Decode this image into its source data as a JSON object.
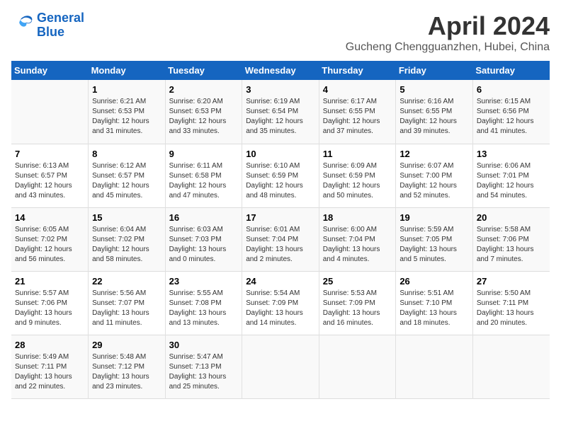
{
  "logo": {
    "line1": "General",
    "line2": "Blue"
  },
  "title": "April 2024",
  "location": "Gucheng Chengguanzhen, Hubei, China",
  "days_header": [
    "Sunday",
    "Monday",
    "Tuesday",
    "Wednesday",
    "Thursday",
    "Friday",
    "Saturday"
  ],
  "weeks": [
    [
      {
        "day": "",
        "info": ""
      },
      {
        "day": "1",
        "info": "Sunrise: 6:21 AM\nSunset: 6:53 PM\nDaylight: 12 hours\nand 31 minutes."
      },
      {
        "day": "2",
        "info": "Sunrise: 6:20 AM\nSunset: 6:53 PM\nDaylight: 12 hours\nand 33 minutes."
      },
      {
        "day": "3",
        "info": "Sunrise: 6:19 AM\nSunset: 6:54 PM\nDaylight: 12 hours\nand 35 minutes."
      },
      {
        "day": "4",
        "info": "Sunrise: 6:17 AM\nSunset: 6:55 PM\nDaylight: 12 hours\nand 37 minutes."
      },
      {
        "day": "5",
        "info": "Sunrise: 6:16 AM\nSunset: 6:55 PM\nDaylight: 12 hours\nand 39 minutes."
      },
      {
        "day": "6",
        "info": "Sunrise: 6:15 AM\nSunset: 6:56 PM\nDaylight: 12 hours\nand 41 minutes."
      }
    ],
    [
      {
        "day": "7",
        "info": "Sunrise: 6:13 AM\nSunset: 6:57 PM\nDaylight: 12 hours\nand 43 minutes."
      },
      {
        "day": "8",
        "info": "Sunrise: 6:12 AM\nSunset: 6:57 PM\nDaylight: 12 hours\nand 45 minutes."
      },
      {
        "day": "9",
        "info": "Sunrise: 6:11 AM\nSunset: 6:58 PM\nDaylight: 12 hours\nand 47 minutes."
      },
      {
        "day": "10",
        "info": "Sunrise: 6:10 AM\nSunset: 6:59 PM\nDaylight: 12 hours\nand 48 minutes."
      },
      {
        "day": "11",
        "info": "Sunrise: 6:09 AM\nSunset: 6:59 PM\nDaylight: 12 hours\nand 50 minutes."
      },
      {
        "day": "12",
        "info": "Sunrise: 6:07 AM\nSunset: 7:00 PM\nDaylight: 12 hours\nand 52 minutes."
      },
      {
        "day": "13",
        "info": "Sunrise: 6:06 AM\nSunset: 7:01 PM\nDaylight: 12 hours\nand 54 minutes."
      }
    ],
    [
      {
        "day": "14",
        "info": "Sunrise: 6:05 AM\nSunset: 7:02 PM\nDaylight: 12 hours\nand 56 minutes."
      },
      {
        "day": "15",
        "info": "Sunrise: 6:04 AM\nSunset: 7:02 PM\nDaylight: 12 hours\nand 58 minutes."
      },
      {
        "day": "16",
        "info": "Sunrise: 6:03 AM\nSunset: 7:03 PM\nDaylight: 13 hours\nand 0 minutes."
      },
      {
        "day": "17",
        "info": "Sunrise: 6:01 AM\nSunset: 7:04 PM\nDaylight: 13 hours\nand 2 minutes."
      },
      {
        "day": "18",
        "info": "Sunrise: 6:00 AM\nSunset: 7:04 PM\nDaylight: 13 hours\nand 4 minutes."
      },
      {
        "day": "19",
        "info": "Sunrise: 5:59 AM\nSunset: 7:05 PM\nDaylight: 13 hours\nand 5 minutes."
      },
      {
        "day": "20",
        "info": "Sunrise: 5:58 AM\nSunset: 7:06 PM\nDaylight: 13 hours\nand 7 minutes."
      }
    ],
    [
      {
        "day": "21",
        "info": "Sunrise: 5:57 AM\nSunset: 7:06 PM\nDaylight: 13 hours\nand 9 minutes."
      },
      {
        "day": "22",
        "info": "Sunrise: 5:56 AM\nSunset: 7:07 PM\nDaylight: 13 hours\nand 11 minutes."
      },
      {
        "day": "23",
        "info": "Sunrise: 5:55 AM\nSunset: 7:08 PM\nDaylight: 13 hours\nand 13 minutes."
      },
      {
        "day": "24",
        "info": "Sunrise: 5:54 AM\nSunset: 7:09 PM\nDaylight: 13 hours\nand 14 minutes."
      },
      {
        "day": "25",
        "info": "Sunrise: 5:53 AM\nSunset: 7:09 PM\nDaylight: 13 hours\nand 16 minutes."
      },
      {
        "day": "26",
        "info": "Sunrise: 5:51 AM\nSunset: 7:10 PM\nDaylight: 13 hours\nand 18 minutes."
      },
      {
        "day": "27",
        "info": "Sunrise: 5:50 AM\nSunset: 7:11 PM\nDaylight: 13 hours\nand 20 minutes."
      }
    ],
    [
      {
        "day": "28",
        "info": "Sunrise: 5:49 AM\nSunset: 7:11 PM\nDaylight: 13 hours\nand 22 minutes."
      },
      {
        "day": "29",
        "info": "Sunrise: 5:48 AM\nSunset: 7:12 PM\nDaylight: 13 hours\nand 23 minutes."
      },
      {
        "day": "30",
        "info": "Sunrise: 5:47 AM\nSunset: 7:13 PM\nDaylight: 13 hours\nand 25 minutes."
      },
      {
        "day": "",
        "info": ""
      },
      {
        "day": "",
        "info": ""
      },
      {
        "day": "",
        "info": ""
      },
      {
        "day": "",
        "info": ""
      }
    ]
  ]
}
